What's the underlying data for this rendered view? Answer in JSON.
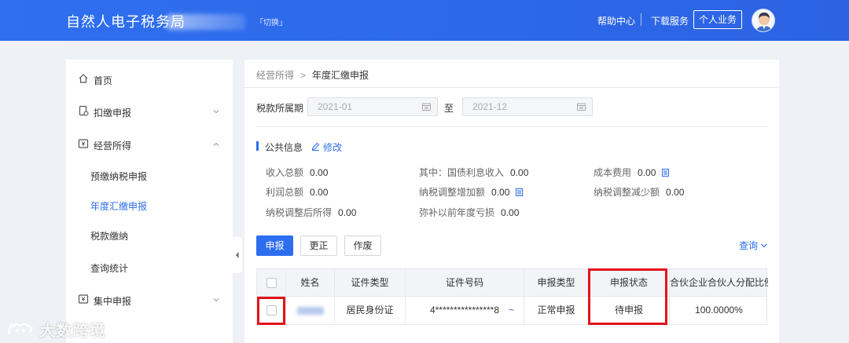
{
  "header": {
    "title": "自然人电子税务局",
    "switch_label": "「切换」",
    "help_center": "帮助中心",
    "download_service": "下载服务",
    "personal_business": "个人业务"
  },
  "sidebar": {
    "items": [
      {
        "label": "首页",
        "icon": "home-icon"
      },
      {
        "label": "扣缴申报",
        "icon": "declaration-icon"
      },
      {
        "label": "经营所得",
        "icon": "yen-icon"
      },
      {
        "label": "集中申报",
        "icon": "yen-icon"
      }
    ],
    "sub_items": [
      {
        "label": "预缴纳税申报"
      },
      {
        "label": "年度汇缴申报"
      },
      {
        "label": "税款缴纳"
      },
      {
        "label": "查询统计"
      }
    ]
  },
  "breadcrumb": {
    "parent": "经营所得",
    "current": "年度汇缴申报"
  },
  "filter": {
    "period_label": "税款所属期",
    "start_value": "2021-01",
    "to_label": "至",
    "end_value": "2021-12"
  },
  "public_info": {
    "title": "公共信息",
    "edit_label": "修改",
    "fields": [
      {
        "label": "收入总额",
        "value": "0.00"
      },
      {
        "label": "其中：国债利息收入",
        "value": "0.00"
      },
      {
        "label": "成本费用",
        "value": "0.00"
      },
      {
        "label": "利润总额",
        "value": "0.00"
      },
      {
        "label": "纳税调整增加额",
        "value": "0.00"
      },
      {
        "label": "纳税调整减少额",
        "value": "0.00"
      },
      {
        "label": "纳税调整后所得",
        "value": "0.00"
      },
      {
        "label": "弥补以前年度亏损",
        "value": "0.00"
      }
    ]
  },
  "actions": {
    "declare": "申报",
    "correct": "更正",
    "void": "作废",
    "query": "查询"
  },
  "table": {
    "columns": [
      "姓名",
      "证件类型",
      "证件号码",
      "申报类型",
      "申报状态",
      "合伙企业合伙人分配比例"
    ],
    "rows": [
      {
        "id_type": "居民身份证",
        "id_number": "4****************8",
        "tilde": "~",
        "declare_type": "正常申报",
        "status": "待申报",
        "ratio": "100.0000%"
      }
    ]
  },
  "watermark": "大数跨境",
  "colors": {
    "primary": "#2d6ef0",
    "highlight": "#e3131b",
    "header": "#2f6ff0"
  }
}
